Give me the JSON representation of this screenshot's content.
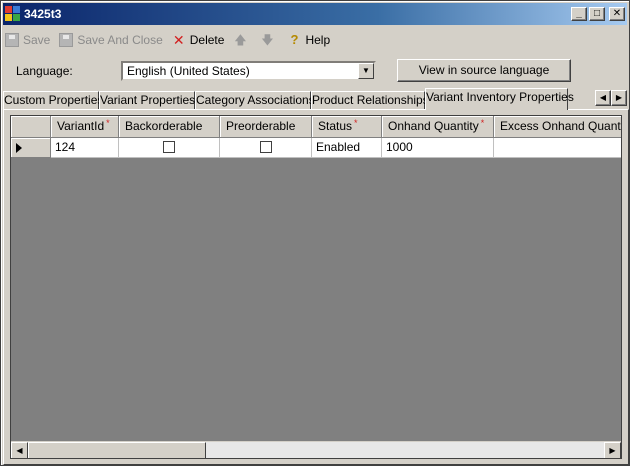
{
  "window": {
    "title": "3425t3"
  },
  "titlebar_buttons": {
    "minimize": "_",
    "maximize": "□",
    "close": "✕"
  },
  "toolbar": {
    "save_label": "Save",
    "save_and_close_label": "Save And Close",
    "delete_label": "Delete",
    "help_label": "Help"
  },
  "icons": {
    "save": "floppy-disk-icon",
    "save_and_close": "floppy-disk-icon",
    "delete": "red-x-icon",
    "move_up": "arrow-up-icon",
    "move_down": "arrow-down-icon",
    "help": "help-icon"
  },
  "language": {
    "label": "Language:",
    "selected": "English (United States)",
    "view_source_label": "View in source language"
  },
  "tabs": [
    {
      "label": "Custom Properties"
    },
    {
      "label": "Variant Properties"
    },
    {
      "label": "Category Associations"
    },
    {
      "label": "Product Relationships"
    },
    {
      "label": "Variant Inventory Properties",
      "active": true
    }
  ],
  "grid": {
    "columns": [
      {
        "label": "VariantId",
        "required": true
      },
      {
        "label": "Backorderable",
        "required": false
      },
      {
        "label": "Preorderable",
        "required": false
      },
      {
        "label": "Status",
        "required": true
      },
      {
        "label": "Onhand Quantity",
        "required": true
      },
      {
        "label": "Excess Onhand Quantity",
        "required": false
      }
    ],
    "required_marker": "*",
    "rows": [
      {
        "variant_id": "124",
        "backorderable": false,
        "preorderable": false,
        "status": "Enabled",
        "onhand_quantity": "1000",
        "excess_onhand_quantity": ""
      }
    ]
  },
  "colors": {
    "title_gradient_start": "#0a246a",
    "title_gradient_end": "#a6caf0",
    "required_marker": "#d21f1f",
    "grid_background": "#808080"
  }
}
